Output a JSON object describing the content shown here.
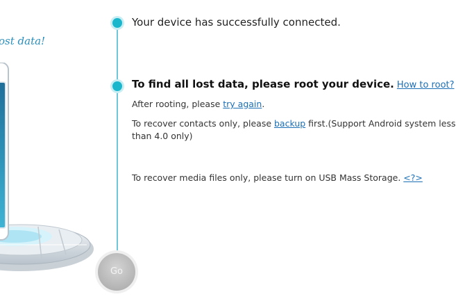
{
  "left_panel": {
    "tagline": "ost data!"
  },
  "steps": {
    "step1": {
      "text": "Your device has successfully connected."
    },
    "step2": {
      "title": "To find all lost data, please root your device.",
      "how_to_root_link": "How to root?",
      "after_rooting_prefix": "After rooting, please ",
      "try_again_link": "try again",
      "after_rooting_suffix": ".",
      "contacts_prefix": "To recover contacts only, please ",
      "backup_link": "backup",
      "contacts_suffix_line1": " first.(Support Android system less",
      "contacts_suffix_line2": "than 4.0 only)",
      "media_text": "To recover media files only, please turn on USB Mass Storage. ",
      "media_help_link": "<?>"
    }
  },
  "go_button": {
    "label": "Go"
  },
  "colors": {
    "accent": "#1ab6cc",
    "link": "#1b6fb5",
    "tagline": "#2a8fbd"
  }
}
